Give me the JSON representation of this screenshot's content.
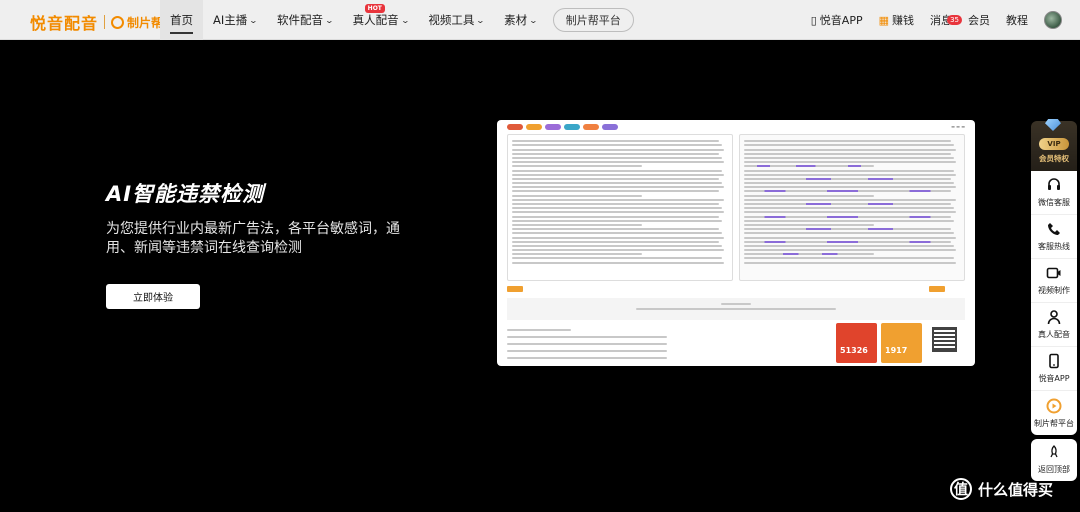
{
  "nav": {
    "logo_main": "悦音配音",
    "logo_sub": "制片帮",
    "menu": [
      {
        "label": "首页",
        "dropdown": false,
        "active": true
      },
      {
        "label": "AI主播",
        "dropdown": true
      },
      {
        "label": "软件配音",
        "dropdown": true
      },
      {
        "label": "真人配音",
        "dropdown": true,
        "badge": "HOT"
      },
      {
        "label": "视频工具",
        "dropdown": true
      },
      {
        "label": "素材",
        "dropdown": true
      }
    ],
    "pill_label": "制片帮平台",
    "right": {
      "app_label": "悦音APP",
      "earn_label": "赚钱",
      "messages_label": "消息",
      "messages_count": "35",
      "member_label": "会员",
      "tutorial_label": "教程"
    }
  },
  "hero": {
    "title": "AI智能违禁检测",
    "description": "为您提供行业内最新广告法，各平台敏感词，通用、新闻等违禁词在线查询检测",
    "button_label": "立即体验"
  },
  "preview": {
    "tag_colors": [
      "#e05a3a",
      "#f0a030",
      "#9b6cd8",
      "#3aa6c8",
      "#f08040",
      "#8a70d8"
    ],
    "stat_left_value": "51326",
    "stat_right_value": "1917",
    "stat_left_color": "#e0442c",
    "stat_right_color": "#f0a030"
  },
  "sidebar": {
    "vip_badge": "VIP",
    "vip_label": "会员特权",
    "items": [
      {
        "label": "微信客服",
        "icon": "headset-icon"
      },
      {
        "label": "客服热线",
        "icon": "phone-icon"
      },
      {
        "label": "视频制作",
        "icon": "video-icon"
      },
      {
        "label": "真人配音",
        "icon": "person-icon"
      },
      {
        "label": "悦音APP",
        "icon": "mobile-icon"
      },
      {
        "label": "制片帮平台",
        "icon": "play-circle-icon"
      }
    ],
    "back_top_label": "返回顶部"
  },
  "watermark": {
    "logo": "值",
    "text": "什么值得买"
  }
}
